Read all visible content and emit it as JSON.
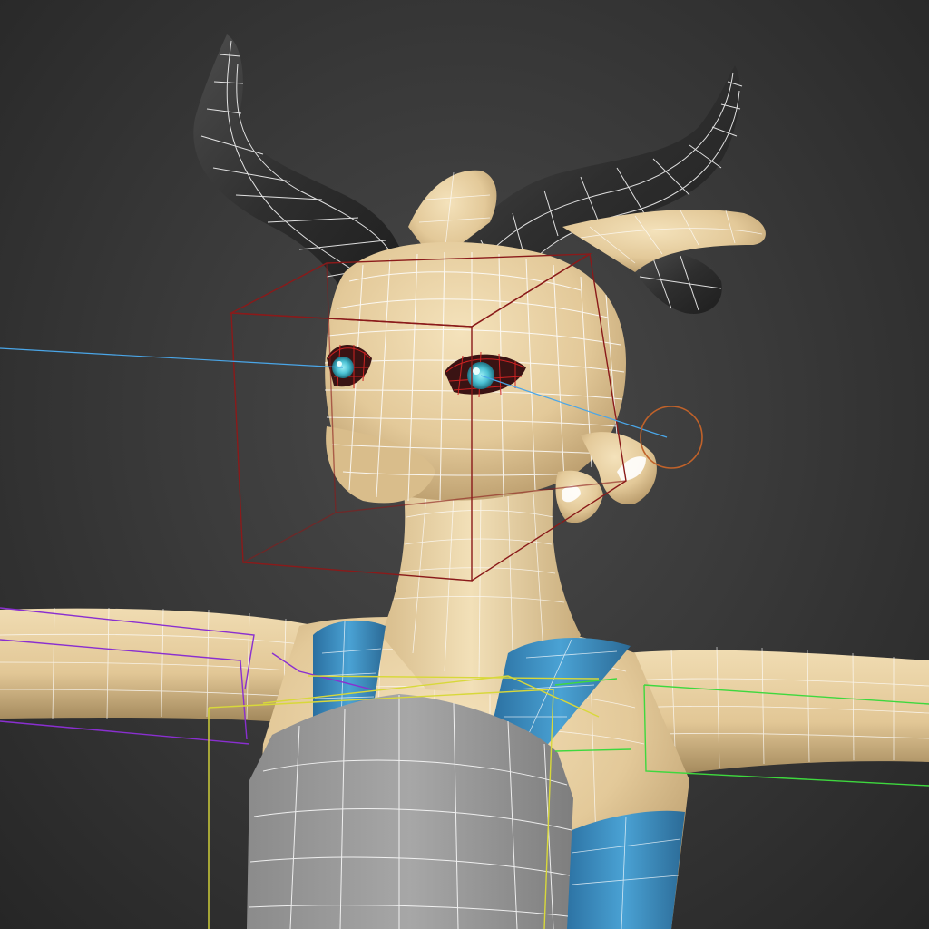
{
  "viewport": {
    "mode": "perspective-wireframe-on-shaded",
    "background": "#3a3a3a",
    "wire_color": "#ffffff"
  },
  "colors": {
    "skin": "#e6cfa0",
    "skin_shadow": "#b99c6e",
    "horn": "#2b2b2b",
    "horn_highlight": "#5a5a5a",
    "strap_blue": "#3b8fc4",
    "pauldron_gray": "#9a9a9a",
    "eye_cyan": "#5cc9d8",
    "eye_cage": "#cc2222",
    "gizmo_red": "#8a1a1a",
    "gizmo_orange": "#c0622a",
    "bone_purple": "#8a2fd0",
    "bone_green": "#3ed83e",
    "bone_yellow": "#d8d83a",
    "look_line_blue": "#4aa6e8"
  },
  "scene_objects": [
    "left-horn",
    "right-horn",
    "head",
    "left-ear",
    "right-ear",
    "left-eye",
    "right-eye",
    "neck",
    "torso",
    "left-arm",
    "right-arm",
    "left-strap",
    "right-strap",
    "chest-armor",
    "head-bounding-box",
    "eye-target-helper",
    "left-arm-bone",
    "right-arm-bone",
    "chest-bone"
  ]
}
